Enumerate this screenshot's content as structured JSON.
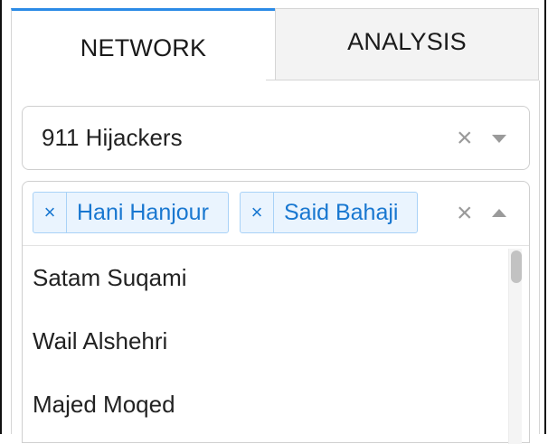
{
  "tabs": [
    {
      "label": "NETWORK",
      "active": true
    },
    {
      "label": "ANALYSIS",
      "active": false
    }
  ],
  "dataset_select": {
    "value": "911 Hijackers",
    "clear_icon": "×",
    "toggle_icon": "chevron-down-icon"
  },
  "people_select": {
    "selected": [
      {
        "remove_icon": "×",
        "label": "Hani Hanjour"
      },
      {
        "remove_icon": "×",
        "label": "Said Bahaji"
      }
    ],
    "clear_icon": "×",
    "toggle_icon": "chevron-up-icon",
    "options": [
      {
        "label": "Satam Suqami"
      },
      {
        "label": "Wail Alshehri"
      },
      {
        "label": "Majed Moqed"
      }
    ]
  },
  "colors": {
    "accent": "#2b8be6",
    "chip_text": "#1877d0",
    "chip_bg": "#eaf4fe",
    "chip_border": "#a9d2f7"
  }
}
